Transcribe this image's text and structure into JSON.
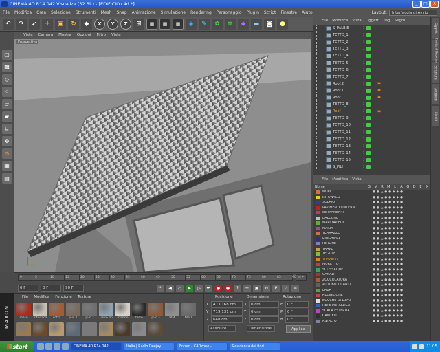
{
  "window": {
    "title": "CINEMA 4D R14.042 Visualize (32 Bit) - [EDIFICIO.c4d *]",
    "buttons": [
      "_",
      "□",
      "X"
    ]
  },
  "menu": {
    "items": [
      "File",
      "Modifica",
      "Crea",
      "Selezione",
      "Strumenti",
      "Mesh",
      "Snap",
      "Animazione",
      "Simulazione",
      "Rendering",
      "Personaggio",
      "Plugin",
      "Script",
      "Finestre",
      "Aiuto"
    ],
    "layout_label": "Layout:",
    "layout_value": "Interfaccia di Avvio"
  },
  "toolbar": {
    "axis_x": "X",
    "axis_y": "Y",
    "axis_z": "Z"
  },
  "viewport": {
    "menu": [
      "Vista",
      "Camera",
      "Mostra",
      "Opzioni",
      "Filtro",
      "Vista"
    ],
    "label": "Prospettiva"
  },
  "timeline": {
    "ticks": [
      "0",
      "5",
      "10",
      "15",
      "20",
      "25",
      "30",
      "35",
      "40",
      "45",
      "50",
      "55",
      "60",
      "65",
      "70",
      "75",
      "80",
      "85",
      "90"
    ],
    "current": "0 F",
    "start": "0 F",
    "end_field": "90 F",
    "end_label": "0 F"
  },
  "materials": {
    "menu": [
      "File",
      "Modifica",
      "Funzione",
      "Texture"
    ],
    "items": [
      {
        "name": "rosso",
        "color": "#b02a1a"
      },
      {
        "name": "intonaco",
        "color": "#c8c2b4"
      },
      {
        "name": "cotto",
        "color": "#a85a30"
      },
      {
        "name": "pvc 1",
        "color": "#7a6b5a"
      },
      {
        "name": "pvc 2",
        "color": "#6e6e6e"
      },
      {
        "name": "vetro fin",
        "color": "#8fa3b0"
      },
      {
        "name": "marmo",
        "color": "#d6d0c8"
      },
      {
        "name": "ferro",
        "color": "#2a2a2a"
      },
      {
        "name": "pvc 3",
        "color": "#8a5a3a"
      },
      {
        "name": "Mat",
        "color": "#909090"
      },
      {
        "name": "tile 1",
        "color": "#6a6a6a"
      },
      {
        "name": "",
        "color": "#9a7a50"
      },
      {
        "name": "",
        "color": "#6b4a2a"
      },
      {
        "name": "",
        "color": "#b89a70"
      },
      {
        "name": "",
        "color": "#5a6a7a"
      },
      {
        "name": "",
        "color": "#7a7a7a"
      },
      {
        "name": "",
        "color": "#a88a60"
      },
      {
        "name": "",
        "color": "#4a3a2a"
      },
      {
        "name": "",
        "color": "#8a8a8a"
      },
      {
        "name": "",
        "color": "#5a4a3a"
      }
    ]
  },
  "maxon": {
    "logo": "MAXON"
  },
  "coords": {
    "head": [
      "Posizione",
      "Dimensione",
      "Rotazione"
    ],
    "rows": [
      {
        "axis": "X",
        "pos": "473.168 cm",
        "size": "0 cm",
        "rot_axis": "H",
        "rot": "0 °"
      },
      {
        "axis": "Y",
        "pos": "719.131 cm",
        "size": "0 cm",
        "rot_axis": "P",
        "rot": "0 °"
      },
      {
        "axis": "Z",
        "pos": "648 cm",
        "size": "0 cm",
        "rot_axis": "B",
        "rot": "0 °"
      }
    ],
    "mode": "Assoluto",
    "size_mode": "Dimensione",
    "apply": "Applica"
  },
  "object_manager": {
    "menu": [
      "File",
      "Modifica",
      "Vista",
      "Oggetti",
      "Tag",
      "Segni"
    ],
    "rows": [
      {
        "name": "S_PALBIE",
        "hl": false,
        "tag": ""
      },
      {
        "name": "TETTO_1",
        "hl": false,
        "tag": ""
      },
      {
        "name": "TETTO_2",
        "hl": false,
        "tag": ""
      },
      {
        "name": "TETTO_3",
        "hl": false,
        "tag": ""
      },
      {
        "name": "TETTO_4",
        "hl": false,
        "tag": ""
      },
      {
        "name": "TETTO_5",
        "hl": false,
        "tag": ""
      },
      {
        "name": "TETTO_6",
        "hl": false,
        "tag": ""
      },
      {
        "name": "TETTO_7",
        "hl": false,
        "tag": ""
      },
      {
        "name": "Roof.2",
        "hl": false,
        "tag": "✱"
      },
      {
        "name": "Roof.1",
        "hl": false,
        "tag": "✱"
      },
      {
        "name": "Roof",
        "hl": false,
        "tag": "✱"
      },
      {
        "name": "TETTO_8",
        "hl": false,
        "tag": ""
      },
      {
        "name": "Roof",
        "hl": true,
        "tag": "✱"
      },
      {
        "name": "TETTO_9",
        "hl": false,
        "tag": ""
      },
      {
        "name": "TETTO_10",
        "hl": false,
        "tag": ""
      },
      {
        "name": "TETTO_11",
        "hl": false,
        "tag": ""
      },
      {
        "name": "TETTO_12",
        "hl": false,
        "tag": ""
      },
      {
        "name": "TETTO_13",
        "hl": false,
        "tag": ""
      },
      {
        "name": "TETTO_14",
        "hl": false,
        "tag": ""
      },
      {
        "name": "TETTO_15",
        "hl": false,
        "tag": ""
      },
      {
        "name": "S_PILI",
        "hl": false,
        "tag": ""
      }
    ]
  },
  "layer_manager": {
    "menu": [
      "File",
      "Modifica",
      "Vista"
    ],
    "head": {
      "name": "Nome",
      "cols": [
        "S",
        "V",
        "R",
        "M",
        "L",
        "A",
        "G",
        "D",
        "E",
        "X"
      ]
    },
    "rows": [
      {
        "name": "MURI",
        "color": "#e07030",
        "hl": false
      },
      {
        "name": "INTONACO",
        "color": "#e0d020",
        "hl": false
      },
      {
        "name": "SOLAIO",
        "color": "#2040c0",
        "hl": false
      },
      {
        "name": "PAVIMENTO INTERNO",
        "color": "#c02020",
        "hl": false
      },
      {
        "name": "SERRAMENTI",
        "color": "#d03060",
        "hl": false
      },
      {
        "name": "BALCONE",
        "color": "#c0c0c0",
        "hl": false
      },
      {
        "name": "MARCIAPIEDI",
        "color": "#60b030",
        "hl": false
      },
      {
        "name": "MARMI",
        "color": "#b040a0",
        "hl": false
      },
      {
        "name": "TERRAZZO",
        "color": "#d07040",
        "hl": false
      },
      {
        "name": "RINGHIERA",
        "color": "#303080",
        "hl": false
      },
      {
        "name": "PERLINE",
        "color": "#8080c0",
        "hl": false
      },
      {
        "name": "TRAVE",
        "color": "#d0a040",
        "hl": false
      },
      {
        "name": "TEGOLE",
        "color": "#80c040",
        "hl": false
      },
      {
        "name": "TRAVETTI",
        "color": "#e08020",
        "hl": true
      },
      {
        "name": "MURETTO",
        "color": "#c04040",
        "hl": false
      },
      {
        "name": "SCOSSALINE",
        "color": "#40a060",
        "hl": false
      },
      {
        "name": "CANALI",
        "color": "#b03030",
        "hl": false
      },
      {
        "name": "ZOCCOLATURA",
        "color": "#a06030",
        "hl": false
      },
      {
        "name": "AUTOBLOCCANTI",
        "color": "#606060",
        "hl": false
      },
      {
        "name": "ERBA",
        "color": "#40b040",
        "hl": false
      },
      {
        "name": "RECINZIONE",
        "color": "#d04040",
        "hl": false
      },
      {
        "name": "BOCCHE DI LUPO",
        "color": "#e0e0e0",
        "hl": false
      },
      {
        "name": "RETE METALLICA",
        "color": "#3060c0",
        "hl": false
      },
      {
        "name": "SCALA ESTERNA",
        "color": "#c040c0",
        "hl": false
      },
      {
        "name": "CANCELLI",
        "color": "#303030",
        "hl": false
      },
      {
        "name": "ASFALTO",
        "color": "#8080a0",
        "hl": false
      }
    ]
  },
  "right_tabs": [
    "Oggetti",
    "Content Browser",
    "Struttura",
    "Attributi",
    "Livelli"
  ],
  "taskbar": {
    "start": "start",
    "tasks": [
      {
        "label": "CINEMA 4D R14.042 ...",
        "active": true
      },
      {
        "label": "Italia | Radio Deejay ...",
        "active": false
      },
      {
        "label": "Forum - C4Dzone - ...",
        "active": false
      },
      {
        "label": "Residenza dei fiori",
        "active": false
      }
    ],
    "clock": "11.05"
  }
}
